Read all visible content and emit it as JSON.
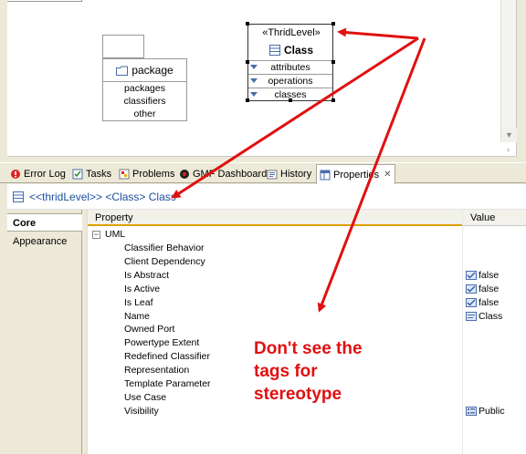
{
  "diagram": {
    "package": {
      "name": "package",
      "compartments": [
        "packages",
        "classifiers",
        "other"
      ]
    },
    "class_element": {
      "stereotype": "«ThridLevel»",
      "name": "Class",
      "compartments": [
        "attributes",
        "operations",
        "classes"
      ]
    }
  },
  "tabs": [
    {
      "label": "Error Log",
      "icon": "error-log-icon"
    },
    {
      "label": "Tasks",
      "icon": "tasks-icon"
    },
    {
      "label": "Problems",
      "icon": "problems-icon"
    },
    {
      "label": "GMF Dashboard",
      "icon": "gmf-dashboard-icon"
    },
    {
      "label": "History",
      "icon": "history-icon"
    },
    {
      "label": "Properties",
      "icon": "properties-icon",
      "active": true
    }
  ],
  "properties_header": {
    "title": "<<thridLevel>> <Class> Class"
  },
  "side_tabs": [
    {
      "label": "Core",
      "active": true
    },
    {
      "label": "Appearance"
    }
  ],
  "table": {
    "columns": [
      "Property",
      "Value"
    ],
    "group": "UML",
    "rows": [
      {
        "name": "Classifier Behavior",
        "value": ""
      },
      {
        "name": "Client Dependency",
        "value": ""
      },
      {
        "name": "Is Abstract",
        "value": "false",
        "value_icon": "boolean-icon"
      },
      {
        "name": "Is Active",
        "value": "false",
        "value_icon": "boolean-icon"
      },
      {
        "name": "Is Leaf",
        "value": "false",
        "value_icon": "boolean-icon"
      },
      {
        "name": "Name",
        "value": "Class",
        "value_icon": "text-icon"
      },
      {
        "name": "Owned Port",
        "value": ""
      },
      {
        "name": "Powertype Extent",
        "value": ""
      },
      {
        "name": "Redefined Classifier",
        "value": ""
      },
      {
        "name": "Representation",
        "value": ""
      },
      {
        "name": "Template Parameter",
        "value": ""
      },
      {
        "name": "Use Case",
        "value": ""
      },
      {
        "name": "Visibility",
        "value": "Public",
        "value_icon": "enum-icon"
      }
    ]
  },
  "annotation": {
    "text": "Don't see the\ntags for\nstereotype",
    "color": "#e01010"
  }
}
